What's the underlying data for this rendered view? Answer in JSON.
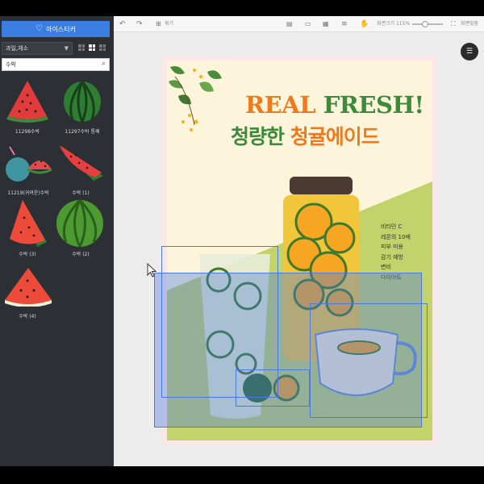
{
  "sidebar": {
    "sticker_button": "아이스티커",
    "category": "과일,채소",
    "search": "수박",
    "items": [
      {
        "label": "11298수박"
      },
      {
        "label": "11297수박 통째"
      },
      {
        "label": "11219(귀여운)수박"
      },
      {
        "label": "수박 (1)"
      },
      {
        "label": "수박 (3)"
      },
      {
        "label": "수박 (2)"
      },
      {
        "label": "수박 (4)"
      }
    ]
  },
  "toolbar": {
    "group_label": "묶기",
    "zoom_label": "화면크기 115%",
    "fit_label": "화면맞춤"
  },
  "poster": {
    "title_en_1": "REAL",
    "title_en_2": "FRESH!",
    "title_ko_1": "청량한",
    "title_ko_2": "청귤에이드",
    "benefits": [
      "비타민 C",
      "레몬의 10배",
      "피부 미용",
      "감기 예방",
      "변비",
      "다이어트"
    ]
  },
  "colors": {
    "accent": "#3b7de0",
    "orange": "#ee7a1c",
    "green": "#3d8a3a",
    "poster_bg": "#fcf5dc",
    "poster_border": "#fbe7e8",
    "table_green": "#c2d36c"
  },
  "icons": {
    "sticker": "heart-icon",
    "search": "search-icon",
    "undo": "undo-icon",
    "redo": "redo-icon",
    "menu": "list-icon"
  }
}
